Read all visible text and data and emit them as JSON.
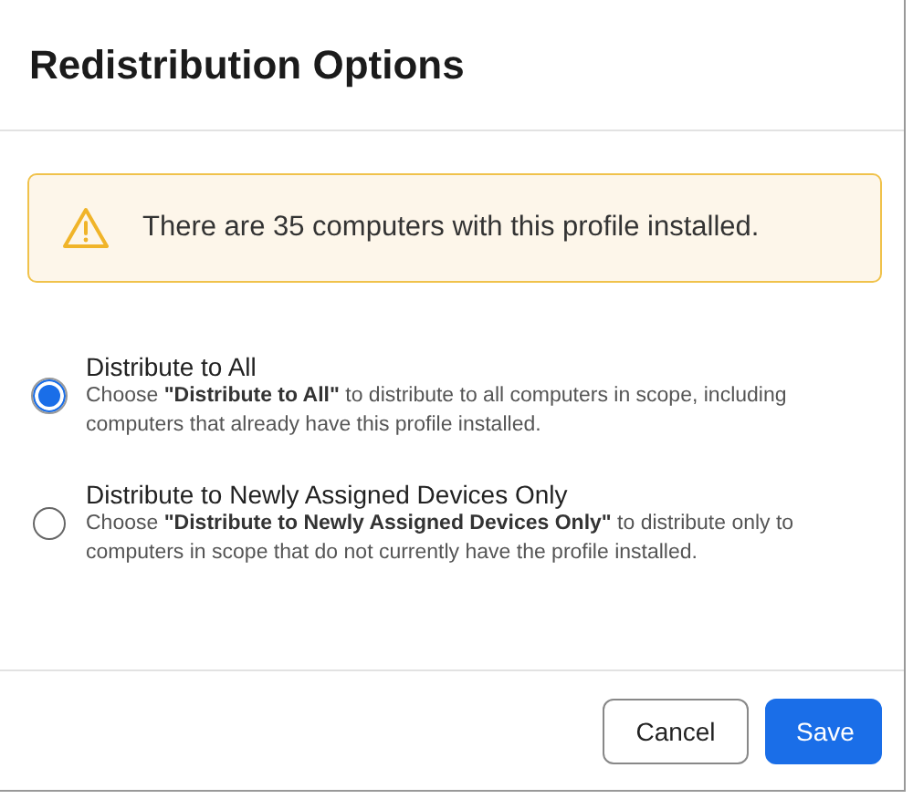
{
  "dialog": {
    "title": "Redistribution Options"
  },
  "alert": {
    "text": "There are 35 computers with this profile installed."
  },
  "options": [
    {
      "label": "Distribute to All",
      "description": "Choose **\"Distribute to All\"** to distribute to all computers in scope, including computers that already have this profile installed.",
      "selected": true
    },
    {
      "label": "Distribute to Newly Assigned Devices Only",
      "description": "Choose **\"Distribute to Newly Assigned Devices Only\"** to distribute only to computers in scope that do not currently have the profile installed.",
      "selected": false
    }
  ],
  "buttons": [
    {
      "label": "Cancel",
      "kind": "secondary"
    },
    {
      "label": "Save",
      "kind": "primary"
    }
  ]
}
